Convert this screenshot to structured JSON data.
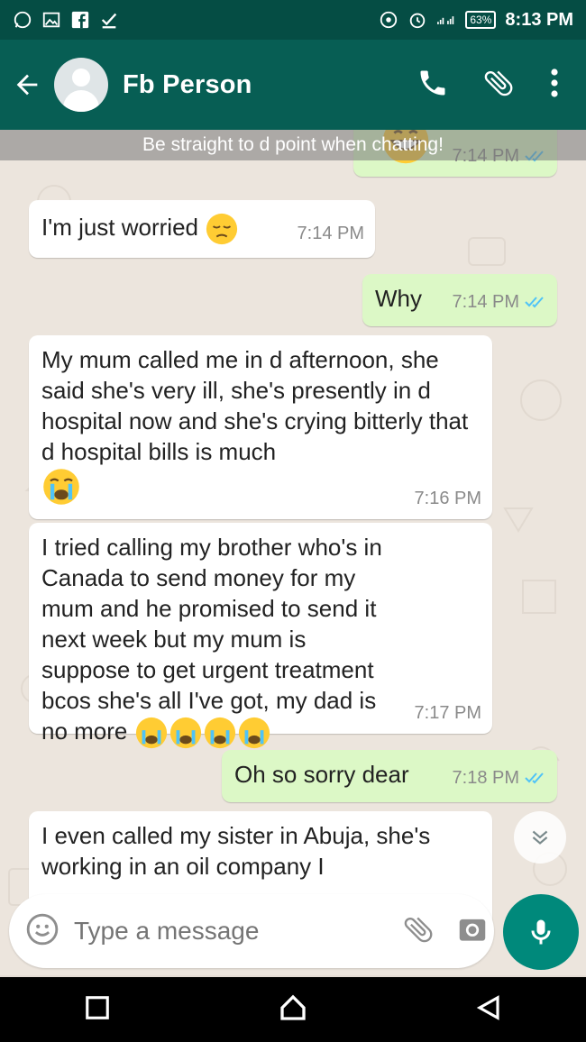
{
  "status": {
    "battery": "63%",
    "time": "8:13 PM"
  },
  "appbar": {
    "contact_name": "Fb Person"
  },
  "banner": {
    "text": "Be straight to d point when chatting!"
  },
  "messages": [
    {
      "dir": "out",
      "text": "",
      "time": "7:14 PM",
      "emoji": "grin"
    },
    {
      "dir": "in",
      "text": "I'm just worried",
      "time": "7:14 PM",
      "emoji": "pensive"
    },
    {
      "dir": "out",
      "text": "Why",
      "time": "7:14 PM"
    },
    {
      "dir": "in",
      "text": "My mum called me in d afternoon, she said she's very ill, she's presently in d hospital now and she's crying bitterly that d hospital bills is much",
      "time": "7:16 PM",
      "emoji": "crying"
    },
    {
      "dir": "in",
      "text": "I tried calling my brother who's in Canada to send money for my mum and he promised to send it next week but my mum is suppose to get urgent treatment bcos she's all I've got, my dad is no more",
      "time": "7:17 PM",
      "emoji": "crying x4"
    },
    {
      "dir": "out",
      "text": "Oh so sorry dear",
      "time": "7:18 PM"
    },
    {
      "dir": "in",
      "text": "I even called my sister in Abuja, she's working in an oil company I",
      "time": ""
    }
  ],
  "composer": {
    "placeholder": "Type a message"
  },
  "icons": {
    "back": "arrow-left-icon",
    "call": "phone-icon",
    "attach": "paperclip-icon",
    "menu": "more-vert-icon",
    "emoji": "smiley-icon",
    "camera": "camera-icon",
    "mic": "mic-icon",
    "scroll": "chevron-double-down-icon"
  },
  "colors": {
    "header": "#075e54",
    "status": "#054d44",
    "outgoing": "#dcf8c6",
    "incoming": "#ffffff",
    "read_ticks": "#4fc3f7",
    "mic_button": "#00897b"
  }
}
